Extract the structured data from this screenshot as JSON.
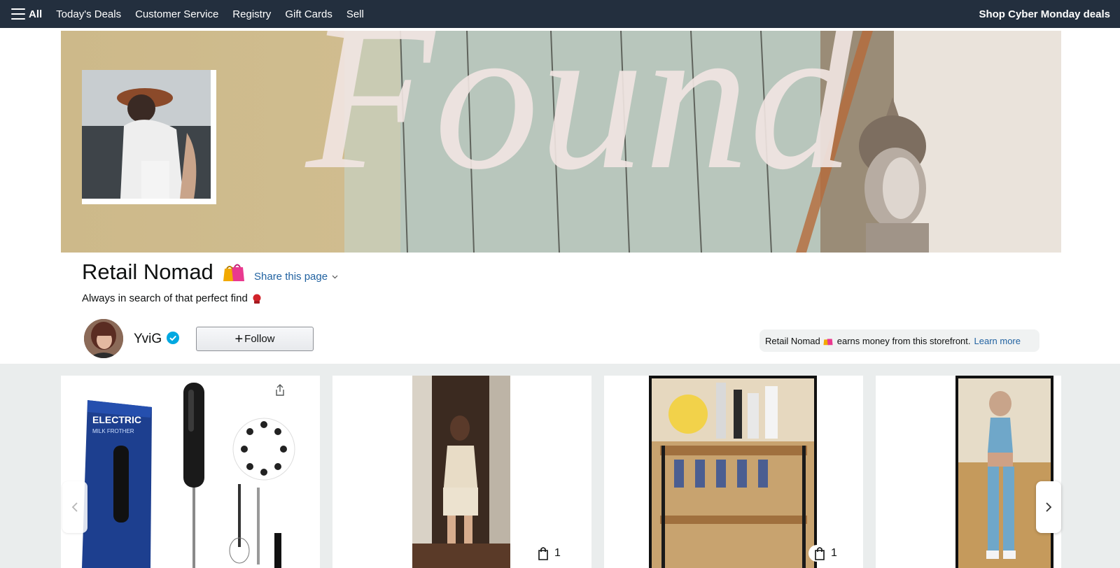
{
  "nav": {
    "all_label": "All",
    "items": [
      {
        "label": "Today's Deals"
      },
      {
        "label": "Customer Service"
      },
      {
        "label": "Registry"
      },
      {
        "label": "Gift Cards"
      },
      {
        "label": "Sell"
      }
    ],
    "promo": "Shop Cyber Monday deals"
  },
  "banner": {
    "word": "Found",
    "icon": "storefront-cover-image"
  },
  "store": {
    "title": "Retail Nomad",
    "title_icon": "shopping-bags-icon",
    "share_label": "Share this page",
    "tagline": "Always in search of that perfect find",
    "tagline_icon": "boxing-glove-icon"
  },
  "creator": {
    "username": "YviG",
    "verified": true,
    "follow_label": "Follow"
  },
  "disclosure": {
    "prefix": "Retail Nomad",
    "text": "earns money from this storefront.",
    "link": "Learn more"
  },
  "cards": [
    {
      "type": "product",
      "image": "electric-milk-frother",
      "box_text_1": "ELECTRIC",
      "box_text_2": "MILK FROTHER",
      "has_share": true
    },
    {
      "type": "photo",
      "image": "mirror-selfie-beige-set",
      "product_count": "1"
    },
    {
      "type": "photo",
      "image": "bar-cart",
      "product_count": "1"
    },
    {
      "type": "photo",
      "image": "mirror-selfie-blue-activewear"
    }
  ],
  "colors": {
    "nav_bg": "#232f3e",
    "link": "#2162a1",
    "verified": "#00a8e1",
    "grid_bg": "#eaeded"
  }
}
